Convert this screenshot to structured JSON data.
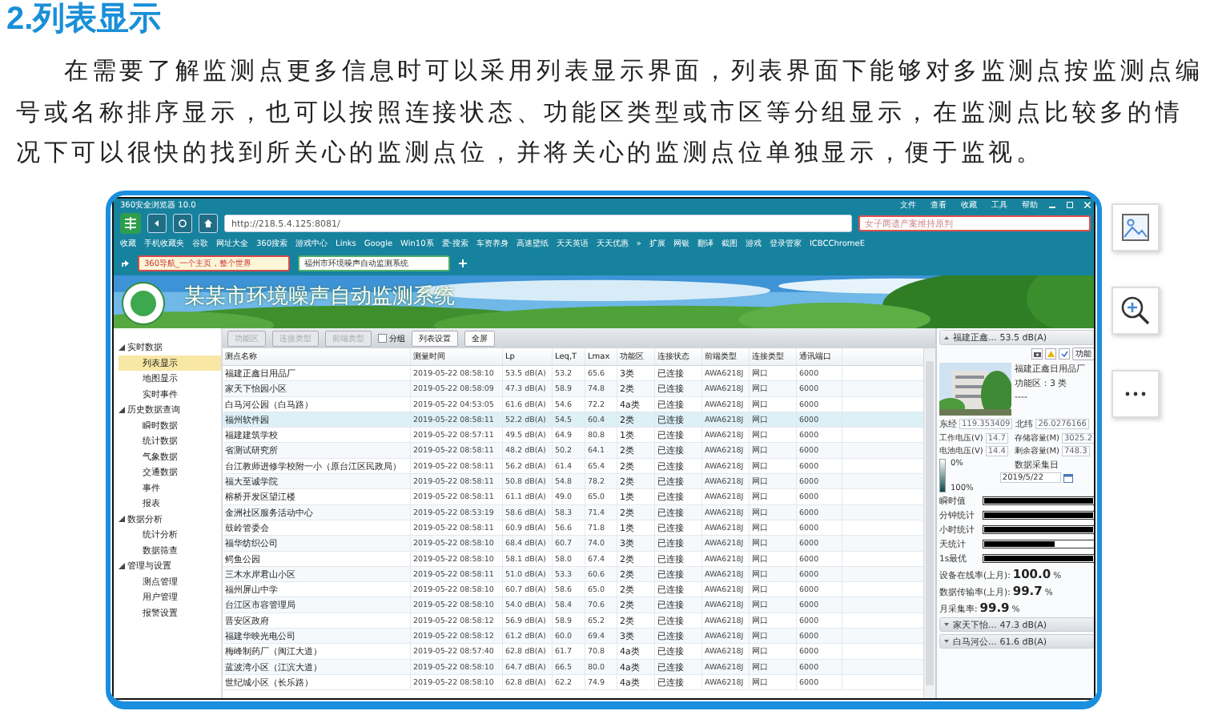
{
  "heading": "2.列表显示",
  "paragraph": "在需要了解监测点更多信息时可以采用列表显示界面，列表界面下能够对多监测点按监测点编号或名称排序显示，也可以按照连接状态、功能区类型或市区等分组显示，在监测点比较多的情况下可以很快的找到所关心的监测点位，并将关心的监测点位单独显示，便于监视。",
  "browser": {
    "title": "360安全浏览器 10.0",
    "menu": [
      "文件",
      "查看",
      "收藏",
      "工具",
      "帮助"
    ],
    "url": "http://218.5.4.125:8081/",
    "search": {
      "placeholder": "女子两遗产案维持原判"
    },
    "bookmarks": [
      "收藏",
      "手机收藏夹",
      "谷歌",
      "网址大全",
      "360搜索",
      "游戏中心",
      "Links",
      "Google",
      "Win10系",
      "爱·搜索",
      "车资养身",
      "高速壁纸",
      "天天英语",
      "天天优惠",
      "»",
      "扩展",
      "网银",
      "翻译",
      "截图",
      "游戏",
      "登录管家",
      "ICBCChromeE"
    ],
    "tabs": [
      {
        "label": "360导航_一个主页，整个世界",
        "selected": false
      },
      {
        "label": "福州市环境噪声自动监测系统",
        "selected": true
      }
    ]
  },
  "app": {
    "title": "某某市环境噪声自动监测系统",
    "nav": [
      {
        "label": "实时数据",
        "expanded": true,
        "children": [
          {
            "label": "列表显示",
            "selected": true
          },
          {
            "label": "地图显示",
            "selected": false
          },
          {
            "label": "实时事件",
            "selected": false
          }
        ]
      },
      {
        "label": "历史数据查询",
        "expanded": true,
        "children": [
          {
            "label": "瞬时数据",
            "selected": false
          },
          {
            "label": "统计数据",
            "selected": false
          },
          {
            "label": "气象数据",
            "selected": false
          },
          {
            "label": "交通数据",
            "selected": false
          },
          {
            "label": "事件",
            "selected": false
          },
          {
            "label": "报表",
            "selected": false
          }
        ]
      },
      {
        "label": "数据分析",
        "expanded": true,
        "children": [
          {
            "label": "统计分析",
            "selected": false
          },
          {
            "label": "数据筛查",
            "selected": false
          }
        ]
      },
      {
        "label": "管理与设置",
        "expanded": true,
        "children": [
          {
            "label": "测点管理",
            "selected": false
          },
          {
            "label": "用户管理",
            "selected": false
          },
          {
            "label": "报警设置",
            "selected": false
          }
        ]
      }
    ],
    "toolbar": [
      {
        "kind": "button",
        "label": "功能区",
        "disabled": true
      },
      {
        "kind": "button",
        "label": "连接类型",
        "disabled": true
      },
      {
        "kind": "button",
        "label": "前端类型",
        "disabled": true
      },
      {
        "kind": "checkbox",
        "label": "分组",
        "checked": false
      },
      {
        "kind": "button",
        "label": "列表设置",
        "disabled": false
      },
      {
        "kind": "button",
        "label": "全屏",
        "disabled": false
      }
    ],
    "table": {
      "columns": [
        "测点名称",
        "测量时间",
        "Lp",
        "Leq,T",
        "Lmax",
        "功能区",
        "连接状态",
        "前端类型",
        "连接类型",
        "通讯端口"
      ],
      "rows": [
        {
          "selected": false,
          "cells": [
            "福建正鑫日用品厂",
            "2019-05-22 08:58:10",
            "53.5 dB(A)",
            "53.2",
            "65.6",
            "3类",
            "已连接",
            "AWA6218J",
            "网口",
            "6000"
          ]
        },
        {
          "selected": false,
          "cells": [
            "家天下怡园小区",
            "2019-05-22 08:58:09",
            "47.3 dB(A)",
            "58.9",
            "74.8",
            "2类",
            "已连接",
            "AWA6218J",
            "网口",
            "6000"
          ]
        },
        {
          "selected": false,
          "cells": [
            "白马河公园（白马路）",
            "2019-05-22 04:53:05",
            "61.6 dB(A)",
            "54.6",
            "72.2",
            "4a类",
            "已连接",
            "AWA6218J",
            "网口",
            "6000"
          ]
        },
        {
          "selected": true,
          "cells": [
            "福州软件园",
            "2019-05-22 08:58:11",
            "52.2 dB(A)",
            "54.5",
            "60.4",
            "2类",
            "已连接",
            "AWA6218J",
            "网口",
            "6000"
          ]
        },
        {
          "selected": false,
          "cells": [
            "福建建筑学校",
            "2019-05-22 08:57:11",
            "49.5 dB(A)",
            "64.9",
            "80.8",
            "1类",
            "已连接",
            "AWA6218J",
            "网口",
            "6000"
          ]
        },
        {
          "selected": false,
          "cells": [
            "省测试研究所",
            "2019-05-22 08:58:11",
            "48.2 dB(A)",
            "50.2",
            "64.1",
            "2类",
            "已连接",
            "AWA6218J",
            "网口",
            "6000"
          ]
        },
        {
          "selected": false,
          "cells": [
            "台江教师进修学校附一小（原台江区民政局）",
            "2019-05-22 08:58:11",
            "56.2 dB(A)",
            "61.4",
            "65.4",
            "2类",
            "已连接",
            "AWA6218J",
            "网口",
            "6000"
          ]
        },
        {
          "selected": false,
          "cells": [
            "福大至诚学院",
            "2019-05-22 08:58:11",
            "50.8 dB(A)",
            "54.8",
            "78.2",
            "2类",
            "已连接",
            "AWA6218J",
            "网口",
            "6000"
          ]
        },
        {
          "selected": false,
          "cells": [
            "榕桥开发区望江楼",
            "2019-05-22 08:58:11",
            "61.1 dB(A)",
            "49.0",
            "65.0",
            "1类",
            "已连接",
            "AWA6218J",
            "网口",
            "6000"
          ]
        },
        {
          "selected": false,
          "cells": [
            "金洲社区服务活动中心",
            "2019-05-22 08:53:19",
            "58.6 dB(A)",
            "58.3",
            "71.4",
            "2类",
            "已连接",
            "AWA6218J",
            "网口",
            "6000"
          ]
        },
        {
          "selected": false,
          "cells": [
            "鼓岭管委会",
            "2019-05-22 08:58:11",
            "60.9 dB(A)",
            "56.6",
            "71.8",
            "1类",
            "已连接",
            "AWA6218J",
            "网口",
            "6000"
          ]
        },
        {
          "selected": false,
          "cells": [
            "福华纺织公司",
            "2019-05-22 08:58:10",
            "68.4 dB(A)",
            "60.7",
            "74.0",
            "3类",
            "已连接",
            "AWA6218J",
            "网口",
            "6000"
          ]
        },
        {
          "selected": false,
          "cells": [
            "鳄鱼公园",
            "2019-05-22 08:58:10",
            "58.1 dB(A)",
            "58.0",
            "67.4",
            "2类",
            "已连接",
            "AWA6218J",
            "网口",
            "6000"
          ]
        },
        {
          "selected": false,
          "cells": [
            "三木水岸君山小区",
            "2019-05-22 08:58:11",
            "51.0 dB(A)",
            "53.3",
            "60.6",
            "2类",
            "已连接",
            "AWA6218J",
            "网口",
            "6000"
          ]
        },
        {
          "selected": false,
          "cells": [
            "福州屏山中学",
            "2019-05-22 08:58:10",
            "60.7 dB(A)",
            "58.6",
            "65.0",
            "2类",
            "已连接",
            "AWA6218J",
            "网口",
            "6000"
          ]
        },
        {
          "selected": false,
          "cells": [
            "台江区市容管理局",
            "2019-05-22 08:58:10",
            "54.0 dB(A)",
            "58.4",
            "70.6",
            "2类",
            "已连接",
            "AWA6218J",
            "网口",
            "6000"
          ]
        },
        {
          "selected": false,
          "cells": [
            "晋安区政府",
            "2019-05-22 08:58:12",
            "56.9 dB(A)",
            "58.9",
            "65.2",
            "2类",
            "已连接",
            "AWA6218J",
            "网口",
            "6000"
          ]
        },
        {
          "selected": false,
          "cells": [
            "福建华映光电公司",
            "2019-05-22 08:58:12",
            "61.2 dB(A)",
            "60.0",
            "69.4",
            "3类",
            "已连接",
            "AWA6218J",
            "网口",
            "6000"
          ]
        },
        {
          "selected": false,
          "cells": [
            "梅峰制药厂（闽江大道）",
            "2019-05-22 08:57:40",
            "62.8 dB(A)",
            "61.7",
            "70.8",
            "4a类",
            "已连接",
            "AWA6218J",
            "网口",
            "6000"
          ]
        },
        {
          "selected": false,
          "cells": [
            "蓝波湾小区（江滨大道）",
            "2019-05-22 08:58:10",
            "64.7 dB(A)",
            "66.5",
            "80.0",
            "4a类",
            "已连接",
            "AWA6218J",
            "网口",
            "6000"
          ]
        },
        {
          "selected": false,
          "cells": [
            "世纪城小区（长乐路）",
            "2019-05-22 08:58:10",
            "62.8 dB(A)",
            "62.2",
            "74.9",
            "4a类",
            "已连接",
            "AWA6218J",
            "网口",
            "6000"
          ]
        }
      ]
    },
    "detail": {
      "header": "福建正鑫...",
      "reading": "53.5 dB(A)",
      "action": "功能",
      "name": "福建正鑫日用品厂",
      "zone": "功能区：3 类",
      "note": "----",
      "coords": [
        {
          "label": "东经",
          "value": "119.353409"
        },
        {
          "label": "北纬",
          "value": "26.0276166"
        }
      ],
      "specs": [
        {
          "label": "工作电压(V)",
          "value": "14.7"
        },
        {
          "label": "存储容量(M)",
          "value": "3025.2"
        },
        {
          "label": "电池电压(V)",
          "value": "14.4"
        },
        {
          "label": "剩余容量(M)",
          "value": "748.3"
        }
      ],
      "legend": [
        "0%",
        "100%"
      ],
      "date_label": "数据采集日",
      "date": "2019/5/22",
      "bars": [
        {
          "label": "瞬时值",
          "level": 1
        },
        {
          "label": "分钟统计",
          "level": 1
        },
        {
          "label": "小时统计",
          "level": 1
        },
        {
          "label": "天统计",
          "level": 0.65
        },
        {
          "label": "1s最优",
          "level": 1
        }
      ],
      "stats": [
        {
          "label": "设备在线率(上月):",
          "value": "100.0",
          "unit": "%"
        },
        {
          "label": "数据传输率(上月):",
          "value": "99.7",
          "unit": "%"
        },
        {
          "label": "月采集率:",
          "value": "99.9",
          "unit": "%"
        }
      ],
      "others": [
        {
          "name": "家天下怡...",
          "reading": "47.3 dB(A)"
        },
        {
          "name": "白马河公...",
          "reading": "61.6 dB(A)"
        }
      ]
    }
  }
}
